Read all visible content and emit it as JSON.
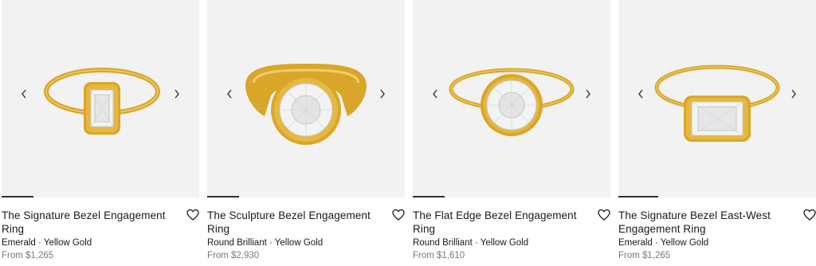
{
  "colors": {
    "gold": "#d9a62a",
    "gold_dark": "#b8871b",
    "card_bg": "#f2f2f2",
    "progress": "#333333"
  },
  "icons": {
    "prev": "chevron-left-icon",
    "next": "chevron-right-icon",
    "wishlist": "heart-icon"
  },
  "products": [
    {
      "title": "The Signature Bezel Engagement Ring",
      "detail": "Emerald · Yellow Gold",
      "price": "From $1,265",
      "carousel_progress": 0.16
    },
    {
      "title": "The Sculpture Bezel Engagement Ring",
      "detail": "Round Brilliant · Yellow Gold",
      "price": "From $2,930",
      "carousel_progress": 0.16
    },
    {
      "title": "The Flat Edge Bezel Engagement Ring",
      "detail": "Round Brilliant · Yellow Gold",
      "price": "From $1,610",
      "carousel_progress": 0.16
    },
    {
      "title": "The Signature Bezel East-West Engagement Ring",
      "detail": "Emerald · Yellow Gold",
      "price": "From $1,265",
      "carousel_progress": 0.2
    }
  ]
}
